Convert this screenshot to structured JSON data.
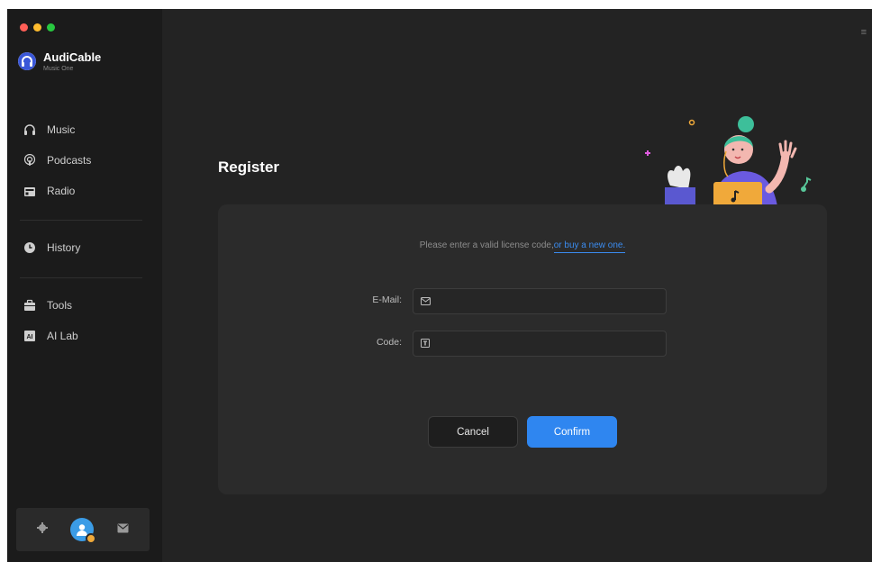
{
  "app": {
    "name": "AudiCable",
    "subtitle": "Music One"
  },
  "sidebar": {
    "items": [
      {
        "label": "Music",
        "icon": "headphones-icon"
      },
      {
        "label": "Podcasts",
        "icon": "podcast-icon"
      },
      {
        "label": "Radio",
        "icon": "radio-icon"
      },
      {
        "label": "History",
        "icon": "clock-icon"
      },
      {
        "label": "Tools",
        "icon": "toolbox-icon"
      },
      {
        "label": "AI Lab",
        "icon": "ai-icon"
      }
    ],
    "bottom": {
      "settings_icon": "gear-icon",
      "avatar_icon": "user-avatar",
      "mail_icon": "mail-icon"
    }
  },
  "main": {
    "title": "Register",
    "hint_text": "Please enter a valid license code,",
    "hint_link": "or buy a new one.",
    "email_label": "E-Mail:",
    "code_label": "Code:",
    "email_value": "",
    "code_value": "",
    "cancel_label": "Cancel",
    "confirm_label": "Confirm"
  },
  "colors": {
    "accent": "#2f86f0",
    "sidebar_bg": "#1b1b1b",
    "main_bg": "#232323",
    "card_bg": "#2b2b2b"
  }
}
